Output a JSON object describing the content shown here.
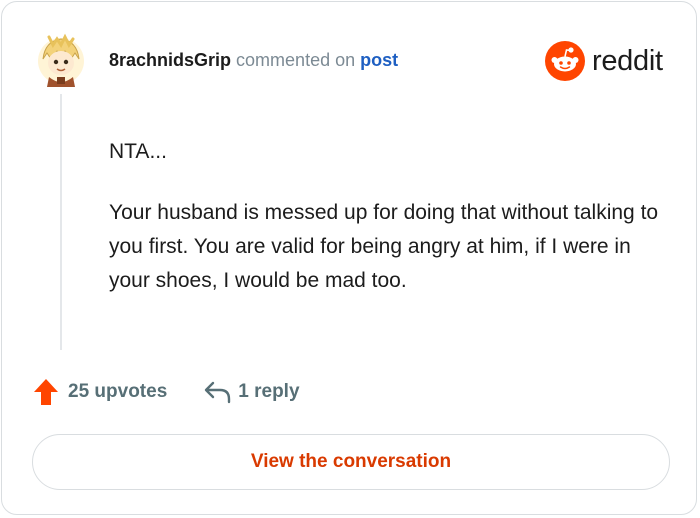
{
  "comment": {
    "username": "8rachnidsGrip",
    "action_text": "commented on",
    "post_link": "post",
    "paragraphs": [
      "NTA...",
      "Your husband is messed up for doing that without talking to you first. You are valid for being angry at him, if I were in your shoes, I would be mad too."
    ]
  },
  "brand": {
    "name": "reddit",
    "accent_color": "#ff4500"
  },
  "stats": {
    "upvotes_label": "25 upvotes",
    "replies_label": "1 reply"
  },
  "cta": {
    "label": "View the conversation",
    "color": "#d93a00"
  },
  "icons": {
    "upvote": "upvote-arrow-icon",
    "reply": "reply-arrow-icon",
    "logo": "reddit-snoo-icon",
    "avatar": "user-avatar"
  }
}
